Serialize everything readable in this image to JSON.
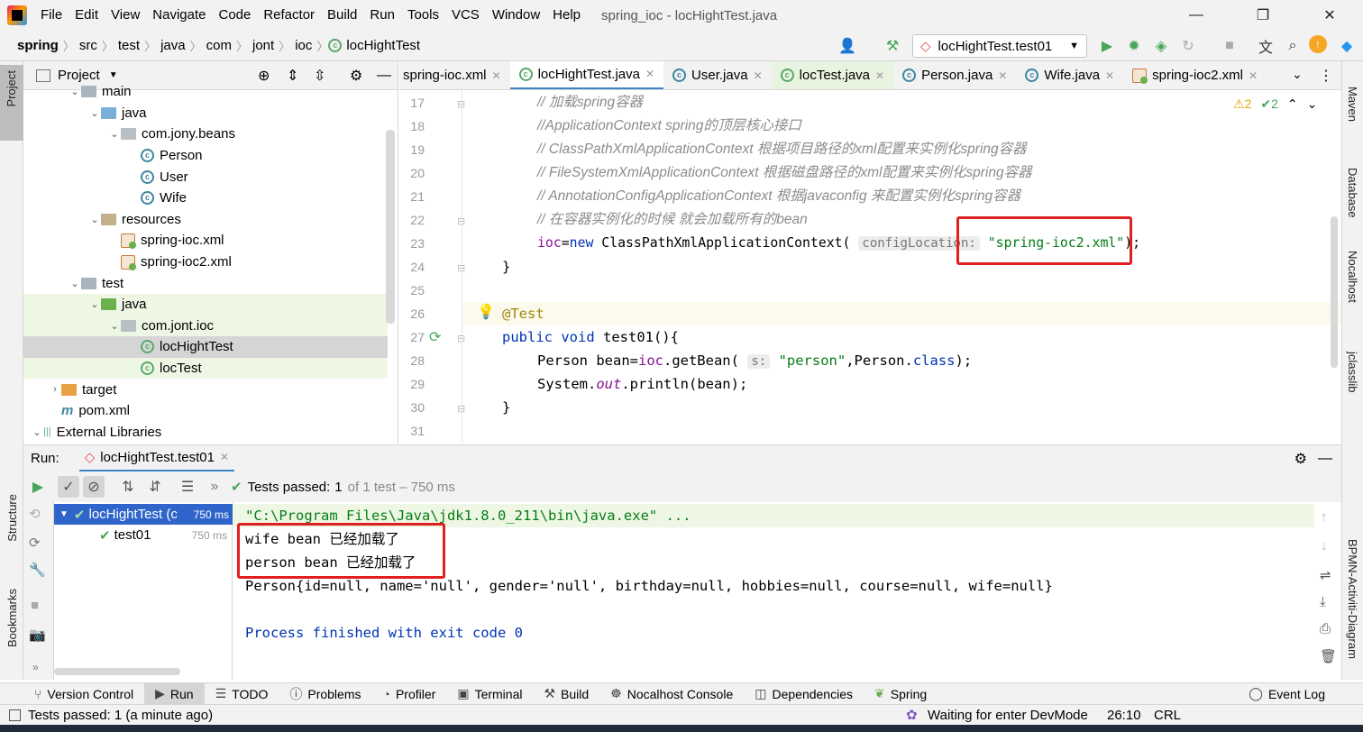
{
  "menubar": {
    "items": [
      "File",
      "Edit",
      "View",
      "Navigate",
      "Code",
      "Refactor",
      "Build",
      "Run",
      "Tools",
      "VCS",
      "Window",
      "Help"
    ],
    "window_title": "spring_ioc - locHightTest.java"
  },
  "navbar": {
    "breadcrumb": [
      "spring",
      "src",
      "test",
      "java",
      "com",
      "jont",
      "ioc",
      "locHightTest"
    ],
    "run_config": "locHightTest.test01"
  },
  "project": {
    "title": "Project",
    "tree": [
      {
        "label": "main",
        "type": "folder",
        "indent": 0,
        "expanded": true
      },
      {
        "label": "java",
        "type": "folder-blue",
        "indent": 1,
        "expanded": true
      },
      {
        "label": "com.jony.beans",
        "type": "package",
        "indent": 2,
        "expanded": true
      },
      {
        "label": "Person",
        "type": "class",
        "indent": 3
      },
      {
        "label": "User",
        "type": "class",
        "indent": 3
      },
      {
        "label": "Wife",
        "type": "class",
        "indent": 3
      },
      {
        "label": "resources",
        "type": "resources",
        "indent": 1,
        "expanded": true
      },
      {
        "label": "spring-ioc.xml",
        "type": "xml",
        "indent": 2
      },
      {
        "label": "spring-ioc2.xml",
        "type": "xml",
        "indent": 2
      },
      {
        "label": "test",
        "type": "folder",
        "indent": 0,
        "expanded": true
      },
      {
        "label": "java",
        "type": "folder-green",
        "indent": 1,
        "expanded": true
      },
      {
        "label": "com.jont.ioc",
        "type": "package",
        "indent": 2,
        "expanded": true
      },
      {
        "label": "locHightTest",
        "type": "class-test",
        "indent": 3,
        "selected": true
      },
      {
        "label": "locTest",
        "type": "class-test",
        "indent": 3
      },
      {
        "label": "target",
        "type": "folder-orange",
        "indent": -1,
        "expanded": false
      },
      {
        "label": "pom.xml",
        "type": "maven",
        "indent": -1
      },
      {
        "label": "External Libraries",
        "type": "libs",
        "indent": -2,
        "expanded": true
      }
    ]
  },
  "tabs": [
    {
      "label": "spring-ioc.xml",
      "icon": "xml"
    },
    {
      "label": "locHightTest.java",
      "icon": "class",
      "active": true
    },
    {
      "label": "User.java",
      "icon": "class"
    },
    {
      "label": "locTest.java",
      "icon": "class",
      "green": true
    },
    {
      "label": "Person.java",
      "icon": "class"
    },
    {
      "label": "Wife.java",
      "icon": "class"
    },
    {
      "label": "spring-ioc2.xml",
      "icon": "xml"
    }
  ],
  "editor": {
    "line_numbers": [
      "17",
      "18",
      "19",
      "20",
      "21",
      "22",
      "23",
      "24",
      "25",
      "26",
      "27",
      "28",
      "29",
      "30",
      "31"
    ],
    "line17": "// 加载spring容器",
    "line18": "//ApplicationContext spring的顶层核心接口",
    "line19": "// ClassPathXmlApplicationContext 根据项目路径的xml配置来实例化spring容器",
    "line20": "// FileSystemXmlApplicationContext 根据磁盘路径的xml配置来实例化spring容器",
    "line21": "// AnnotationConfigApplicationContext 根据javaconfig 来配置实例化spring容器",
    "line22": "// 在容器实例化的时候 就会加载所有的bean",
    "line23_a": "ioc",
    "line23_b": "=",
    "line23_c": "new",
    "line23_d": " ClassPathXmlApplicationContext(",
    "line23_hint": "configLocation:",
    "line23_str": "\"spring-ioc2.xml\"",
    "line23_end": ");",
    "line24": "}",
    "line26": "@Test",
    "line27_a": "public void",
    "line27_b": " test01(){",
    "line28_a": "Person bean=",
    "line28_b": "ioc",
    "line28_c": ".getBean(",
    "line28_hint": "s:",
    "line28_str": "\"person\"",
    "line28_d": ",Person.",
    "line28_e": "class",
    "line28_f": ");",
    "line29_a": "System.",
    "line29_b": "out",
    "line29_c": ".println(bean);",
    "line30": "}",
    "warnings": "2",
    "checks": "2"
  },
  "run": {
    "label": "Run:",
    "tab": "locHightTest.test01",
    "status_prefix": "Tests passed:",
    "status_count": "1",
    "status_rest": "of 1 test – 750 ms",
    "tree": [
      {
        "label": "locHightTest (c",
        "time": "750 ms",
        "selected": true
      },
      {
        "label": "test01",
        "time": "750 ms"
      }
    ],
    "console": [
      "\"C:\\Program Files\\Java\\jdk1.8.0_211\\bin\\java.exe\" ...",
      "wife bean 已经加载了",
      "person bean 已经加载了",
      "Person{id=null, name='null', gender='null', birthday=null, hobbies=null, course=null, wife=null}",
      "",
      "Process finished with exit code 0"
    ]
  },
  "bottom_tabs": [
    "Version Control",
    "Run",
    "TODO",
    "Problems",
    "Profiler",
    "Terminal",
    "Build",
    "Nocalhost Console",
    "Dependencies",
    "Spring",
    "Event Log"
  ],
  "left_strip": [
    "Project",
    "Structure",
    "Bookmarks"
  ],
  "right_strip": [
    "Maven",
    "Database",
    "Nocalhost",
    "jclasslib",
    "BPMN-Activiti-Diagram"
  ],
  "statusbar": {
    "left": "Tests passed: 1 (a minute ago)",
    "devmode": "Waiting for enter DevMode",
    "position": "26:10",
    "line_ending": "CRL"
  },
  "colors": {
    "accent": "#4083c9",
    "highlight_red": "#e02020",
    "pass_green": "#4aa65a"
  }
}
